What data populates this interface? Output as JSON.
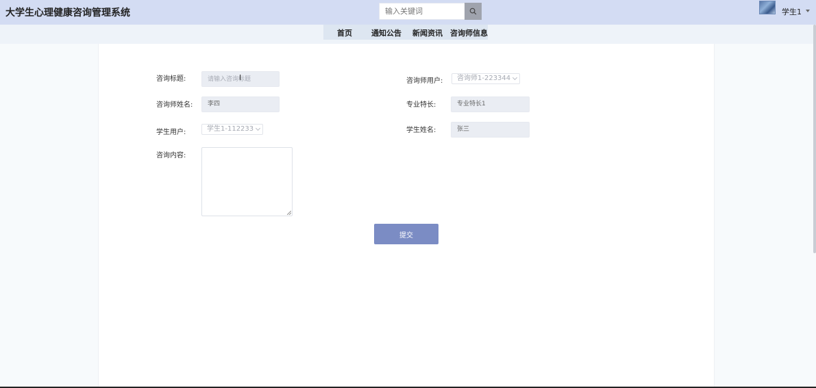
{
  "header": {
    "app_title": "大学生心理健康咨询管理系统",
    "search_placeholder": "输入关键词",
    "user_name": "学生1"
  },
  "nav": {
    "items": [
      {
        "label": "首页"
      },
      {
        "label": "通知公告"
      },
      {
        "label": "新闻资讯"
      },
      {
        "label": "咨询师信息"
      }
    ]
  },
  "form": {
    "title_label": "咨询标题:",
    "title_placeholder": "请输入咨询标题",
    "counselor_user_label": "咨询师用户:",
    "counselor_user_value": "咨询师1-223344",
    "counselor_name_label": "咨询师姓名:",
    "counselor_name_value": "李四",
    "specialty_label": "专业特长:",
    "specialty_value": "专业特长1",
    "student_user_label": "学生用户:",
    "student_user_value": "学生1-112233",
    "student_name_label": "学生姓名:",
    "student_name_value": "张三",
    "content_label": "咨询内容:",
    "content_value": "",
    "submit_label": "提交"
  }
}
